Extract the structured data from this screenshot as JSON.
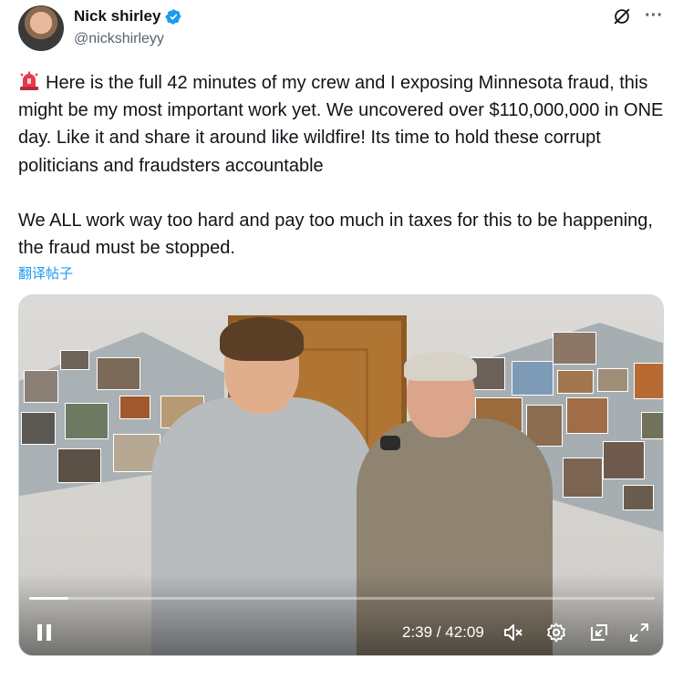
{
  "author": {
    "display_name": "Nick shirley",
    "handle": "@nickshirleyy",
    "verified": true
  },
  "header_actions": {
    "grok_icon": "grok-icon",
    "more_icon": "more-icon",
    "more_label": "···"
  },
  "tweet": {
    "emoji_icon": "siren-icon",
    "text": "Here is the full 42 minutes of my crew and I exposing Minnesota fraud, this might be my most important work yet. We uncovered over $110,000,000 in ONE day. Like it and share it around like wildfire! Its time to hold these corrupt politicians and fraudsters accountable\n\nWe ALL work way too hard and pay too much in taxes for this to be happening, the fraud must be stopped.",
    "translate_label": "翻译帖子"
  },
  "video": {
    "current_time": "2:39",
    "duration": "42:09",
    "time_display": "2:39 / 42:09",
    "progress": 0.063,
    "state": "playing",
    "controls": [
      "pause-icon",
      "mute-icon",
      "settings-icon",
      "picture-in-picture-icon",
      "fullscreen-icon"
    ]
  },
  "colors": {
    "accent": "#1d9bf0",
    "text_primary": "#0f1419",
    "text_secondary": "#536471"
  }
}
